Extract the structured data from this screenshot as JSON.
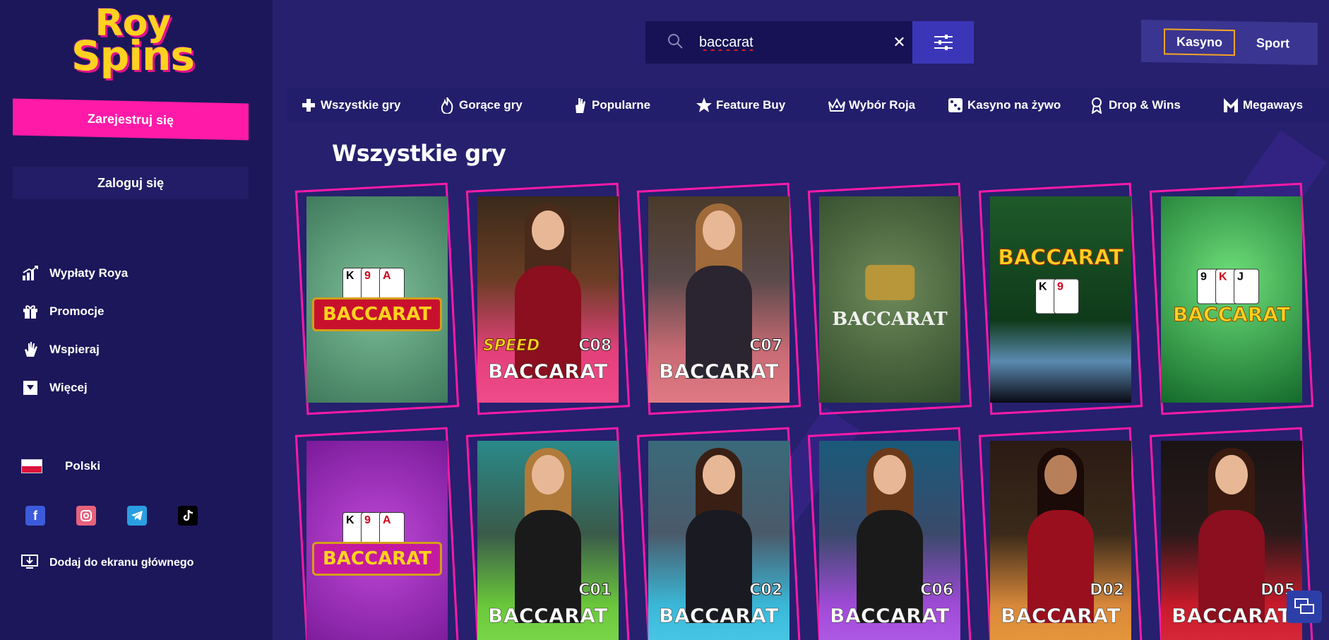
{
  "brand": {
    "logo_line1": "Roy",
    "logo_line2": "Spins",
    "accent": "#ff1aa8",
    "logo_color": "#ffd21f"
  },
  "sidebar": {
    "register_label": "Zarejestruj się",
    "login_label": "Zaloguj się",
    "items": [
      {
        "label": "Wypłaty Roya",
        "icon": "chart-up-icon"
      },
      {
        "label": "Promocje",
        "icon": "gift-icon"
      },
      {
        "label": "Wspieraj",
        "icon": "hand-icon"
      },
      {
        "label": "Więcej",
        "icon": "dropdown-box-icon"
      }
    ],
    "language": "Polski",
    "socials": [
      "facebook-icon",
      "instagram-icon",
      "telegram-icon",
      "tiktok-icon"
    ],
    "add_home_label": "Dodaj do ekranu głównego"
  },
  "search": {
    "value": "baccarat",
    "icon": "search-icon"
  },
  "mode": {
    "casino_label": "Kasyno",
    "sport_label": "Sport",
    "active": "Kasyno"
  },
  "categories": [
    {
      "label": "Wszystkie gry",
      "icon": "puzzle-icon"
    },
    {
      "label": "Gorące gry",
      "icon": "fire-icon"
    },
    {
      "label": "Popularne",
      "icon": "thumbs-up-icon"
    },
    {
      "label": "Feature Buy",
      "icon": "star-icon"
    },
    {
      "label": "Wybór Roja",
      "icon": "crown-icon"
    },
    {
      "label": "Kasyno na żywo",
      "icon": "dice-icon"
    },
    {
      "label": "Drop & Wins",
      "icon": "drop-wins-icon"
    },
    {
      "label": "Megaways",
      "icon": "megaways-icon"
    }
  ],
  "section_title": "Wszystkie gry",
  "games": [
    {
      "label": "BACCARAT",
      "code": "",
      "speed": ""
    },
    {
      "label": "BACCARAT",
      "code": "C08",
      "speed": "SPEED"
    },
    {
      "label": "BACCARAT",
      "code": "C07",
      "speed": ""
    },
    {
      "label": "BACCARAT",
      "code": "",
      "speed": ""
    },
    {
      "label": "BACCARAT",
      "code": "",
      "speed": ""
    },
    {
      "label": "BACCARAT",
      "code": "",
      "speed": ""
    },
    {
      "label": "BACCARAT",
      "code": "",
      "speed": ""
    },
    {
      "label": "BACCARAT",
      "code": "C01",
      "speed": ""
    },
    {
      "label": "BACCARAT",
      "code": "C02",
      "speed": ""
    },
    {
      "label": "BACCARAT",
      "code": "C06",
      "speed": ""
    },
    {
      "label": "BACCARAT",
      "code": "D02",
      "speed": ""
    },
    {
      "label": "BACCARAT",
      "code": "D05",
      "speed": ""
    }
  ]
}
